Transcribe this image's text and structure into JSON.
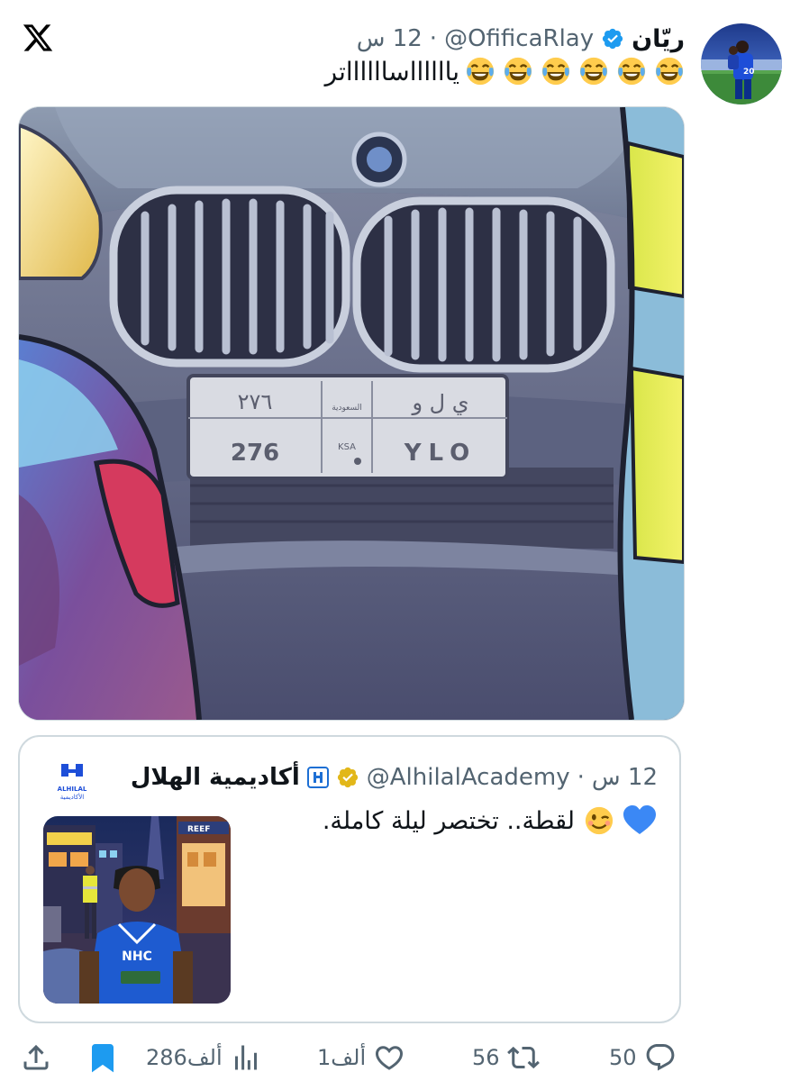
{
  "colors": {
    "accent": "#1d9bf0",
    "text": "#0f1419",
    "muted": "#536471",
    "border": "#cfd9de",
    "verified_gold": "#e2b719"
  },
  "post": {
    "display_name": "ريّان",
    "handle": "@OfificaRlay",
    "separator": "·",
    "time": "12 س",
    "text": "يااااااسااااااتر",
    "emoji": "face-with-tears-of-joy",
    "emoji_count": 6
  },
  "media": {
    "plate": {
      "arabic_number": "٢٧٦",
      "number": "276",
      "arabic_letters": "ي ل و",
      "letters": "YLO",
      "ksa_arabic": "السعودية",
      "ksa": "KSA"
    }
  },
  "quote": {
    "display_name": "أكاديمية الهلال",
    "handle": "@AlhilalAcademy",
    "separator": "·",
    "time": "12 س",
    "text": "لقطة.. تختصر ليلة كاملة.",
    "emojis": [
      "winking-face",
      "blue-heart"
    ],
    "avatar_caption_top": "ALHILAL",
    "avatar_caption_bottom": "الأكاديمية",
    "thumb_sign": "REEF",
    "jersey_sponsor": "NHC"
  },
  "actions": {
    "replies": "50",
    "reposts": "56",
    "likes": "1ألف",
    "views": "286ألف"
  },
  "icons": [
    "x-logo-icon",
    "verified-badge-icon",
    "reply-icon",
    "repost-icon",
    "like-icon",
    "views-icon",
    "bookmark-icon",
    "share-icon"
  ]
}
